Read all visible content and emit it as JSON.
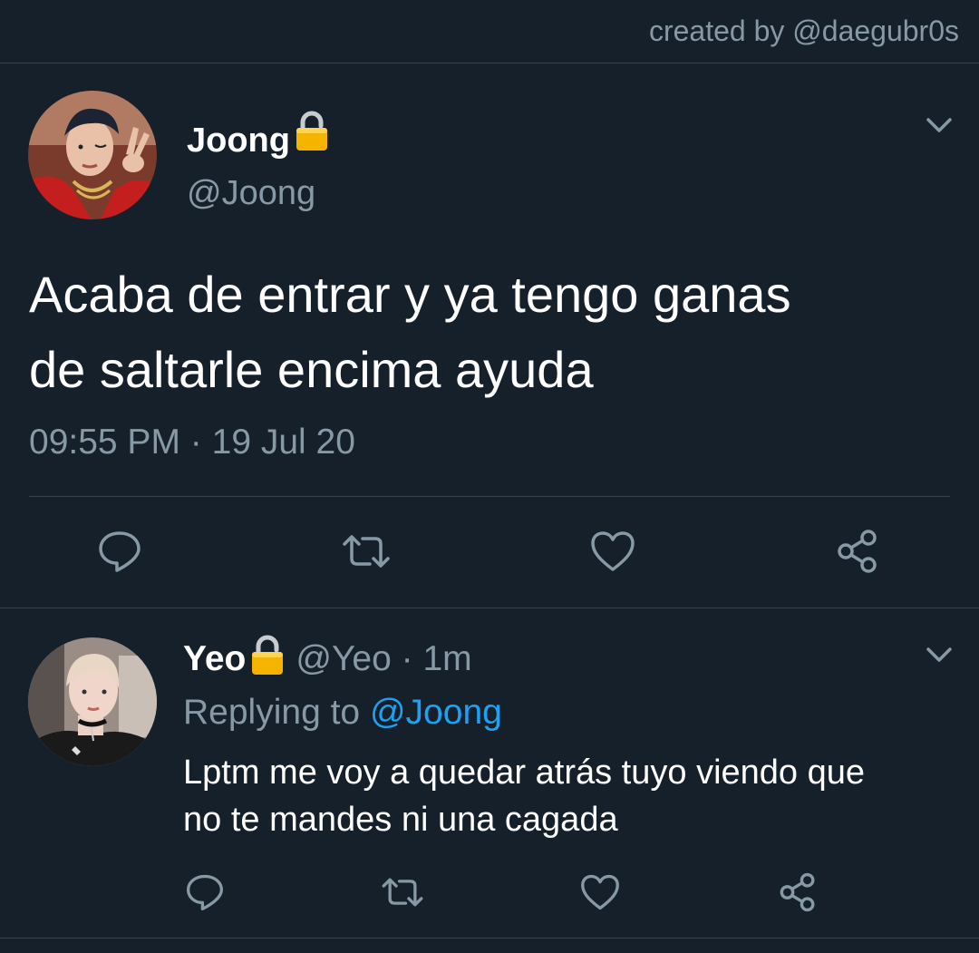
{
  "watermark": "created by @daegubr0s",
  "main_tweet": {
    "display_name": "Joong",
    "handle": "@Joong",
    "text": "Acaba de entrar y ya tengo ganas\nde saltarle encima ayuda",
    "time": "09:55 PM",
    "separator": "·",
    "date": "19 Jul 20",
    "actions": [
      "reply-icon",
      "retweet-icon",
      "like-icon",
      "share-icon"
    ]
  },
  "reply_tweet": {
    "display_name": "Yeo",
    "handle": "@Yeo",
    "separator": "·",
    "age": "1m",
    "replying_prefix": "Replying to",
    "replying_handle": "@Joong",
    "text": "Lptm me voy a quedar atrás tuyo viendo que\nno te mandes ni una cagada",
    "actions": [
      "reply-icon",
      "retweet-icon",
      "like-icon",
      "share-icon"
    ]
  },
  "colors": {
    "background": "#15202b",
    "muted": "#8899a6",
    "link": "#1da1f2",
    "divider": "#38444d",
    "lock": "#f5b400"
  }
}
